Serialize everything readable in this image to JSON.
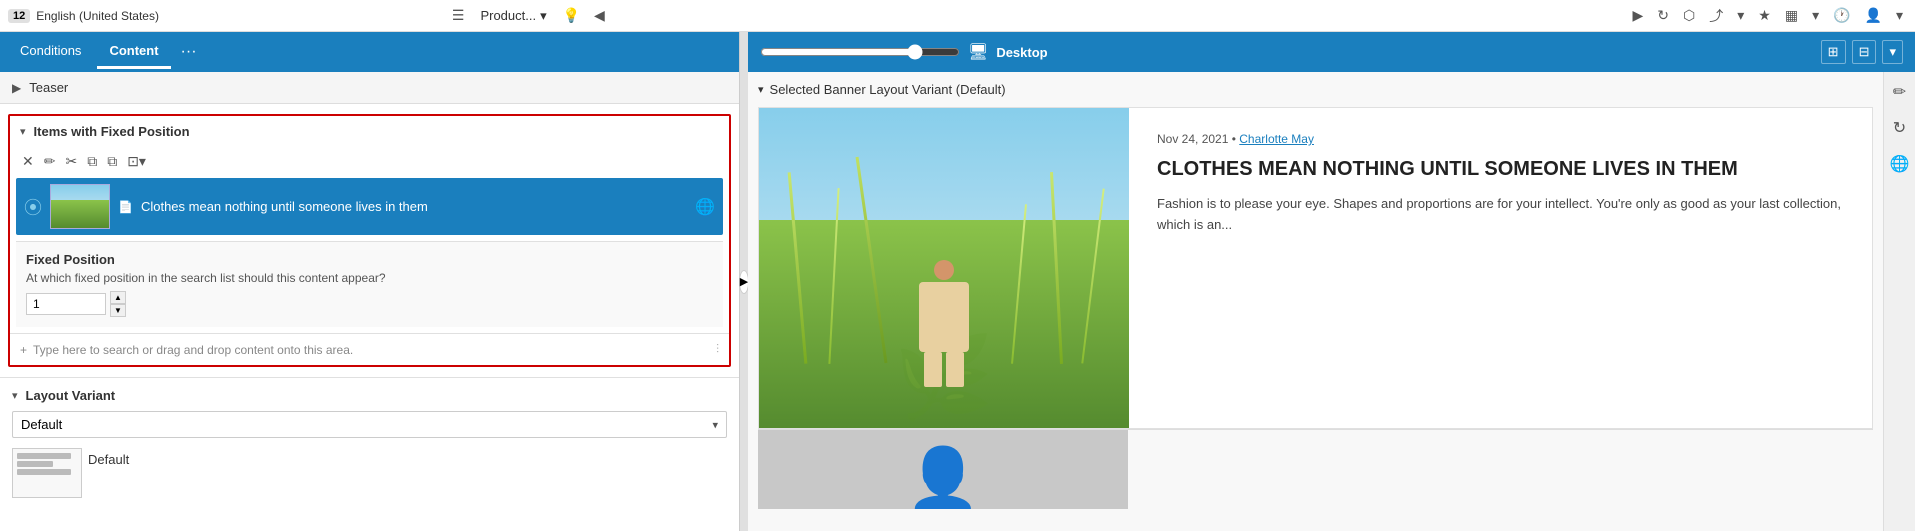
{
  "topbar": {
    "version": "12",
    "language": "English (United States)",
    "product_label": "Product...",
    "nav_forward": "▶",
    "nav_back": "◀"
  },
  "left_panel": {
    "tabs": [
      {
        "id": "conditions",
        "label": "Conditions",
        "active": false
      },
      {
        "id": "content",
        "label": "Content",
        "active": true
      },
      {
        "id": "more",
        "label": "···",
        "active": false
      }
    ],
    "teaser": {
      "label": "Teaser"
    },
    "items_section": {
      "title": "Items with Fixed Position",
      "item": {
        "label": "Clothes mean nothing until someone lives in them",
        "doc_icon": "📄",
        "globe_icon": "🌐"
      },
      "fixed_position": {
        "title": "Fixed Position",
        "description": "At which fixed position in the search list should this content appear?",
        "value": "1"
      },
      "add_placeholder": "Type here to search or drag and drop content onto this area."
    },
    "layout_section": {
      "title": "Layout Variant",
      "selected": "Default",
      "options": [
        "Default"
      ],
      "preview_label": "Default"
    }
  },
  "right_panel": {
    "toolbar": {
      "desktop_label": "Desktop",
      "view_icons": [
        "⊞",
        "⊟"
      ]
    },
    "preview": {
      "banner_header": "Selected Banner Layout Variant (Default)",
      "article": {
        "meta": "Nov 24, 2021 • Charlotte May",
        "author_link": "Charlotte May",
        "title": "CLOTHES MEAN NOTHING UNTIL SOMEONE LIVES IN THEM",
        "description": "Fashion is to please your eye. Shapes and proportions are for your intellect. You're only as good as your last collection, which is an..."
      }
    }
  },
  "icons": {
    "close": "✕",
    "edit": "✏",
    "cut": "✂",
    "copy": "⧉",
    "paste": "⧉",
    "more": "▾",
    "chevron_down": "▾",
    "chevron_right": "▶",
    "chevron_left": "◀",
    "plus": "+",
    "chart": "⫶",
    "globe": "🌐",
    "refresh": "↻",
    "share": "↗",
    "star": "★",
    "image": "🖼",
    "clock": "🕐",
    "person": "👤",
    "pencil": "✏",
    "layers": "⧉",
    "nav_arrow_right": "▶",
    "nav_arrow_left": "◀"
  }
}
